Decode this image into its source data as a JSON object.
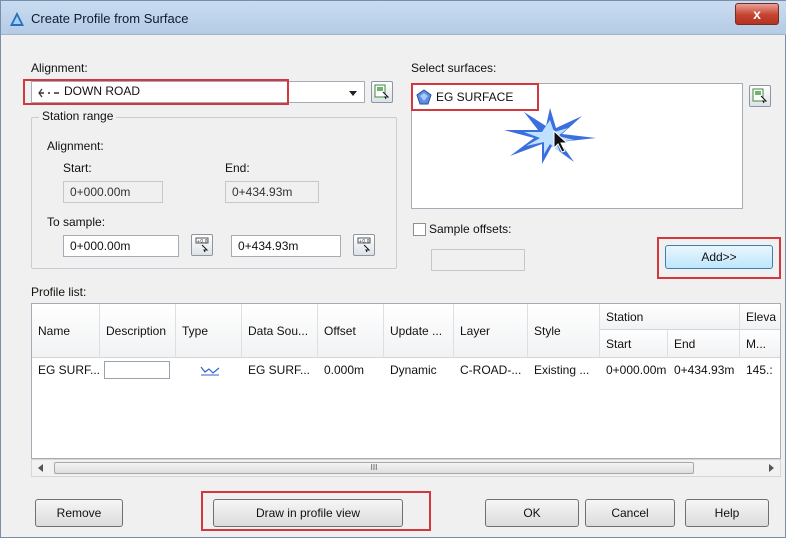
{
  "window": {
    "title": "Create Profile from Surface",
    "close": "x"
  },
  "alignment": {
    "label": "Alignment:",
    "value": "DOWN ROAD"
  },
  "station_range": {
    "title": "Station range",
    "alignment_label": "Alignment:",
    "start_label": "Start:",
    "end_label": "End:",
    "start_value": "0+000.00m",
    "end_value": "0+434.93m",
    "to_sample_label": "To sample:",
    "sample_start": "0+000.00m",
    "sample_end": "0+434.93m"
  },
  "surfaces": {
    "label": "Select surfaces:",
    "items": [
      "EG SURFACE"
    ]
  },
  "sample_offsets": {
    "label": "Sample offsets:",
    "checked": false,
    "value": ""
  },
  "add_button": "Add>>",
  "profile_list": {
    "label": "Profile list:",
    "columns": {
      "name": "Name",
      "description": "Description",
      "type": "Type",
      "data_source": "Data Sou...",
      "offset": "Offset",
      "update": "Update ...",
      "layer": "Layer",
      "style": "Style",
      "station": "Station",
      "station_start": "Start",
      "station_end": "End",
      "elevation": "Eleva",
      "elevation_sub": "M..."
    },
    "rows": [
      {
        "name": "EG SURF...",
        "description": "",
        "data_source": "EG SURF...",
        "offset": "0.000m",
        "update": "Dynamic",
        "layer": "C-ROAD-...",
        "style": "Existing ...",
        "start": "0+000.00m",
        "end": "0+434.93m",
        "elevation": "145.:"
      }
    ]
  },
  "scrollbar": {
    "thumb_grip": "III"
  },
  "buttons": {
    "remove": "Remove",
    "draw": "Draw in profile view",
    "ok": "OK",
    "cancel": "Cancel",
    "help": "Help"
  }
}
